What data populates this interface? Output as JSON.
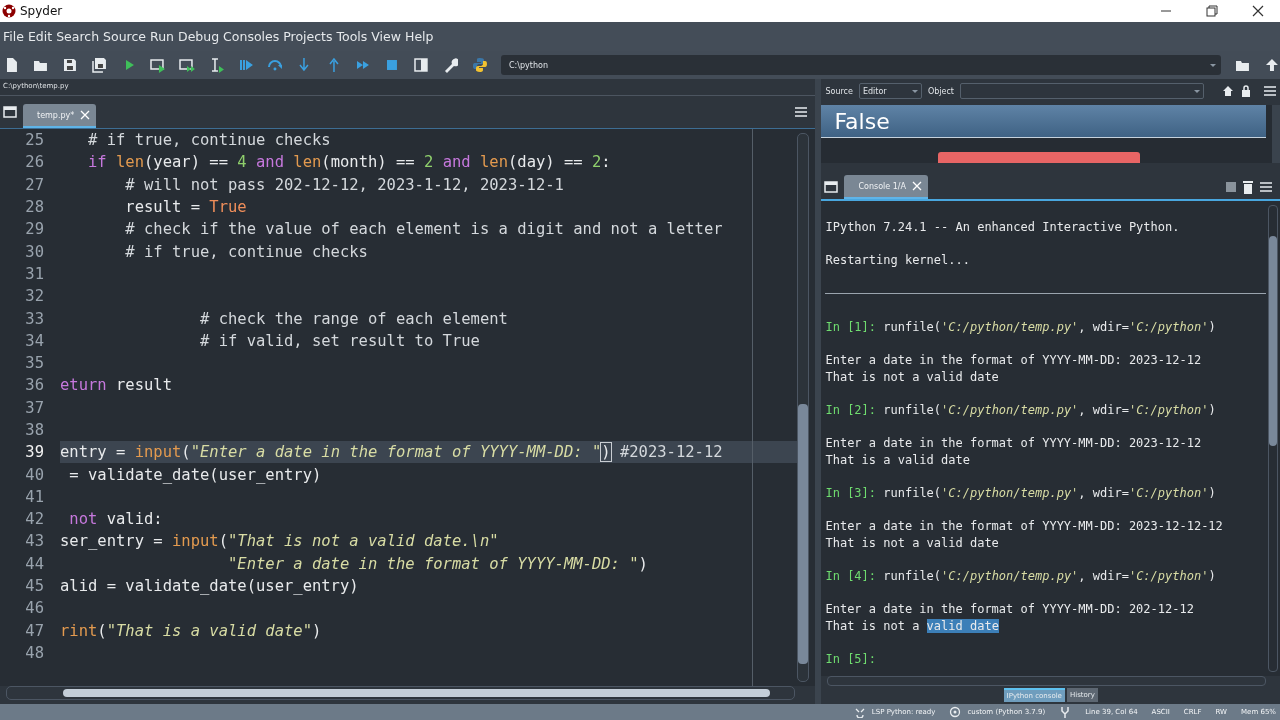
{
  "window": {
    "title": "Spyder"
  },
  "menu": [
    "File",
    "Edit",
    "Search",
    "Source",
    "Run",
    "Debug",
    "Consoles",
    "Projects",
    "Tools",
    "View",
    "Help"
  ],
  "toolbar": {
    "working_directory": "C:\\python"
  },
  "path_bar": "C:\\python\\temp.py",
  "editor": {
    "tabs": [
      {
        "label": "temp.py*",
        "selected": true
      }
    ],
    "lines": [
      {
        "number": "25",
        "current": false,
        "tokens": [
          {
            "kind": "com",
            "text": "   # if true, continue checks"
          }
        ]
      },
      {
        "number": "26",
        "current": false,
        "tokens": [
          {
            "kind": "kw",
            "text": "   if"
          },
          {
            "kind": "builtin",
            "text": " len"
          },
          {
            "kind": "plain",
            "text": "(year) == "
          },
          {
            "kind": "num",
            "text": "4"
          },
          {
            "kind": "kw",
            "text": " and"
          },
          {
            "kind": "builtin",
            "text": " len"
          },
          {
            "kind": "plain",
            "text": "(month) == "
          },
          {
            "kind": "num",
            "text": "2"
          },
          {
            "kind": "kw",
            "text": " and"
          },
          {
            "kind": "builtin",
            "text": " len"
          },
          {
            "kind": "plain",
            "text": "(day) == "
          },
          {
            "kind": "num",
            "text": "2"
          },
          {
            "kind": "plain",
            "text": ":"
          }
        ]
      },
      {
        "number": "27",
        "current": false,
        "tokens": [
          {
            "kind": "com",
            "text": "       # will not pass 202-12-12, 2023-1-12, 2023-12-1"
          }
        ]
      },
      {
        "number": "28",
        "current": false,
        "tokens": [
          {
            "kind": "plain",
            "text": "       result = "
          },
          {
            "kind": "const",
            "text": "True"
          }
        ]
      },
      {
        "number": "29",
        "current": false,
        "tokens": [
          {
            "kind": "com",
            "text": "       # check if the value of each element is a digit and not a letter"
          }
        ]
      },
      {
        "number": "30",
        "current": false,
        "tokens": [
          {
            "kind": "com",
            "text": "       # if true, continue checks"
          }
        ]
      },
      {
        "number": "31",
        "current": false
      },
      {
        "number": "32",
        "current": false
      },
      {
        "number": "33",
        "current": false,
        "tokens": [
          {
            "kind": "com",
            "text": "               # check the range of each element"
          }
        ]
      },
      {
        "number": "34",
        "current": false,
        "tokens": [
          {
            "kind": "com",
            "text": "               # if valid, set result to True"
          }
        ]
      },
      {
        "number": "35",
        "current": false
      },
      {
        "number": "36",
        "current": false,
        "tokens": [
          {
            "kind": "kw",
            "text": "eturn"
          },
          {
            "kind": "plain",
            "text": " result"
          }
        ]
      },
      {
        "number": "37",
        "current": false
      },
      {
        "number": "38",
        "current": false
      },
      {
        "number": "39",
        "current": true,
        "tokens": [
          {
            "kind": "plain",
            "text": "entry = "
          },
          {
            "kind": "builtin",
            "text": "input"
          },
          {
            "kind": "plain",
            "text": "("
          },
          {
            "kind": "str",
            "text": "\"Enter a date in the format of YYYY-MM-DD: \""
          },
          {
            "kind": "match",
            "text": ")"
          },
          {
            "kind": "com",
            "text": " #2023-12-12"
          }
        ]
      },
      {
        "number": "40",
        "current": false,
        "tokens": [
          {
            "kind": "plain",
            "text": " = validate_date(user_entry)"
          }
        ]
      },
      {
        "number": "41",
        "current": false
      },
      {
        "number": "42",
        "current": false,
        "tokens": [
          {
            "kind": "kw",
            "text": " not"
          },
          {
            "kind": "plain",
            "text": " valid:"
          }
        ]
      },
      {
        "number": "43",
        "current": false,
        "tokens": [
          {
            "kind": "plain",
            "text": "ser_entry = "
          },
          {
            "kind": "builtin",
            "text": "input"
          },
          {
            "kind": "plain",
            "text": "("
          },
          {
            "kind": "str",
            "text": "\"That is not a valid date.\\n\""
          }
        ]
      },
      {
        "number": "44",
        "current": false,
        "tokens": [
          {
            "kind": "str",
            "text": "                  \"Enter a date in the format of YYYY-MM-DD: \""
          },
          {
            "kind": "plain",
            "text": ")"
          }
        ]
      },
      {
        "number": "45",
        "current": false,
        "tokens": [
          {
            "kind": "plain",
            "text": "alid = validate_date(user_entry)"
          }
        ]
      },
      {
        "number": "46",
        "current": false
      },
      {
        "number": "47",
        "current": false,
        "tokens": [
          {
            "kind": "builtin",
            "text": "rint"
          },
          {
            "kind": "plain",
            "text": "("
          },
          {
            "kind": "str",
            "text": "\"That is a valid date\""
          },
          {
            "kind": "plain",
            "text": ")"
          }
        ]
      },
      {
        "number": "48",
        "current": false
      }
    ]
  },
  "help": {
    "source_label": "Source",
    "source": "Editor",
    "object_label": "Object",
    "heading": "False"
  },
  "console": {
    "tabs": [
      {
        "label": "Console 1/A",
        "selected": true
      }
    ],
    "lines": [
      {
        "kind": "text",
        "segments": [
          {
            "kind": "plain",
            "text": "IPython 7.24.1 -- An enhanced Interactive Python."
          }
        ]
      },
      {
        "kind": "blank"
      },
      {
        "kind": "text",
        "segments": [
          {
            "kind": "plain",
            "text": "Restarting kernel..."
          }
        ]
      },
      {
        "kind": "blank"
      },
      {
        "kind": "rule"
      },
      {
        "kind": "blank"
      },
      {
        "kind": "text",
        "segments": [
          {
            "kind": "prompt",
            "text": "In [1]:"
          },
          {
            "kind": "plain",
            "text": " runfile("
          },
          {
            "kind": "str",
            "text": "'C:/python/temp.py'"
          },
          {
            "kind": "plain",
            "text": ", wdir="
          },
          {
            "kind": "str",
            "text": "'C:/python'"
          },
          {
            "kind": "plain",
            "text": ")"
          }
        ]
      },
      {
        "kind": "blank"
      },
      {
        "kind": "text",
        "segments": [
          {
            "kind": "plain",
            "text": "Enter a date in the format of YYYY-MM-DD: 2023-12-12"
          }
        ]
      },
      {
        "kind": "text",
        "segments": [
          {
            "kind": "plain",
            "text": "That is not a valid date"
          }
        ]
      },
      {
        "kind": "blank"
      },
      {
        "kind": "text",
        "segments": [
          {
            "kind": "prompt",
            "text": "In [2]:"
          },
          {
            "kind": "plain",
            "text": " runfile("
          },
          {
            "kind": "str",
            "text": "'C:/python/temp.py'"
          },
          {
            "kind": "plain",
            "text": ", wdir="
          },
          {
            "kind": "str",
            "text": "'C:/python'"
          },
          {
            "kind": "plain",
            "text": ")"
          }
        ]
      },
      {
        "kind": "blank"
      },
      {
        "kind": "text",
        "segments": [
          {
            "kind": "plain",
            "text": "Enter a date in the format of YYYY-MM-DD: 2023-12-12"
          }
        ]
      },
      {
        "kind": "text",
        "segments": [
          {
            "kind": "plain",
            "text": "That is a valid date"
          }
        ]
      },
      {
        "kind": "blank"
      },
      {
        "kind": "text",
        "segments": [
          {
            "kind": "prompt",
            "text": "In [3]:"
          },
          {
            "kind": "plain",
            "text": " runfile("
          },
          {
            "kind": "str",
            "text": "'C:/python/temp.py'"
          },
          {
            "kind": "plain",
            "text": ", wdir="
          },
          {
            "kind": "str",
            "text": "'C:/python'"
          },
          {
            "kind": "plain",
            "text": ")"
          }
        ]
      },
      {
        "kind": "blank"
      },
      {
        "kind": "text",
        "segments": [
          {
            "kind": "plain",
            "text": "Enter a date in the format of YYYY-MM-DD: 2023-12-12-12"
          }
        ]
      },
      {
        "kind": "text",
        "segments": [
          {
            "kind": "plain",
            "text": "That is not a valid date"
          }
        ]
      },
      {
        "kind": "blank"
      },
      {
        "kind": "text",
        "segments": [
          {
            "kind": "prompt",
            "text": "In [4]:"
          },
          {
            "kind": "plain",
            "text": " runfile("
          },
          {
            "kind": "str",
            "text": "'C:/python/temp.py'"
          },
          {
            "kind": "plain",
            "text": ", wdir="
          },
          {
            "kind": "str",
            "text": "'C:/python'"
          },
          {
            "kind": "plain",
            "text": ")"
          }
        ]
      },
      {
        "kind": "blank"
      },
      {
        "kind": "text",
        "segments": [
          {
            "kind": "plain",
            "text": "Enter a date in the format of YYYY-MM-DD: 202-12-12"
          }
        ]
      },
      {
        "kind": "text",
        "segments": [
          {
            "kind": "plain",
            "text": "That is not a "
          },
          {
            "kind": "selected",
            "text": "valid date"
          }
        ]
      },
      {
        "kind": "blank"
      },
      {
        "kind": "text",
        "segments": [
          {
            "kind": "prompt",
            "text": "In [5]:"
          }
        ]
      }
    ]
  },
  "bottom_tabs": [
    {
      "label": "IPython console",
      "selected": true
    },
    {
      "label": "History",
      "selected": false
    }
  ],
  "status_bar": [
    {
      "kind": "lsp",
      "text": "LSP Python: ready"
    },
    {
      "kind": "env",
      "text": "custom (Python 3.7.9)"
    },
    {
      "kind": "git"
    },
    {
      "kind": "plain",
      "text": "Line 39, Col 64"
    },
    {
      "kind": "plain",
      "text": "ASCII"
    },
    {
      "kind": "plain",
      "text": "CRLF"
    },
    {
      "kind": "plain",
      "text": "RW"
    },
    {
      "kind": "plain",
      "text": "Mem 65%"
    }
  ]
}
